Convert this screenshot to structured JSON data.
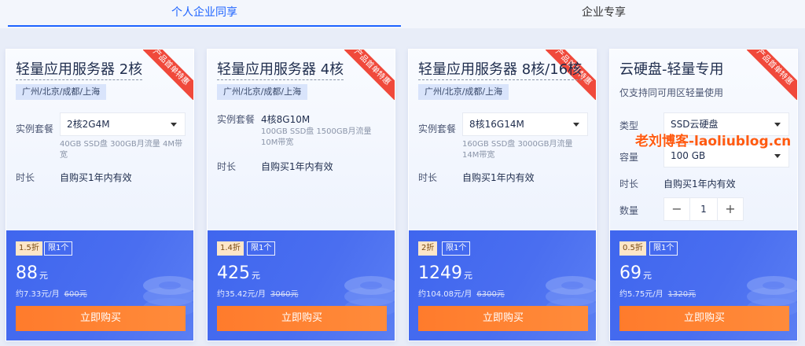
{
  "tabs": [
    "个人企业同享",
    "企业专享"
  ],
  "ribbon_text": "产品首单特惠",
  "labels": {
    "plan": "实例套餐",
    "duration": "时长",
    "type": "类型",
    "capacity": "容量",
    "quantity": "数量",
    "limit": "限1个",
    "yuan": "元",
    "buy": "立即购买"
  },
  "cards": [
    {
      "title": "轻量应用服务器 2核",
      "region": "广州/北京/成都/上海",
      "plan_value": "2核2G4M",
      "desc": "40GB SSD盘 300GB月流量 4M带宽",
      "duration": "自购买1年内有效",
      "discount": "1.5折",
      "price": "88",
      "monthly": "约7.33元/月",
      "original": "600元"
    },
    {
      "title": "轻量应用服务器 4核",
      "region": "广州/北京/成都/上海",
      "plan_value": "4核8G10M",
      "desc": "100GB SSD盘 1500GB月流量 10M带宽",
      "duration": "自购买1年内有效",
      "discount": "1.4折",
      "price": "425",
      "monthly": "约35.42元/月",
      "original": "3060元"
    },
    {
      "title": "轻量应用服务器 8核/16核",
      "region": "广州/北京/成都/上海",
      "plan_value": "8核16G14M",
      "desc": "160GB SSD盘 3000GB月流量 14M带宽",
      "duration": "自购买1年内有效",
      "discount": "2折",
      "price": "1249",
      "monthly": "约104.08元/月",
      "original": "6300元"
    },
    {
      "title": "云硬盘-轻量专用",
      "subtitle": "仅支持同可用区轻量使用",
      "type_value": "SSD云硬盘",
      "capacity_value": "100 GB",
      "duration": "自购买1年内有效",
      "quantity": "1",
      "discount": "0.5折",
      "price": "69",
      "monthly": "约5.75元/月",
      "original": "1320元"
    }
  ],
  "watermark": "老刘博客-laoliublog.cn",
  "colors": {
    "accent": "#1d63ff",
    "ribbon": "#f0493b",
    "panel": "#4a6ef0",
    "buy_button": "#ff7b2c",
    "discount_badge": "#fde6c8"
  }
}
